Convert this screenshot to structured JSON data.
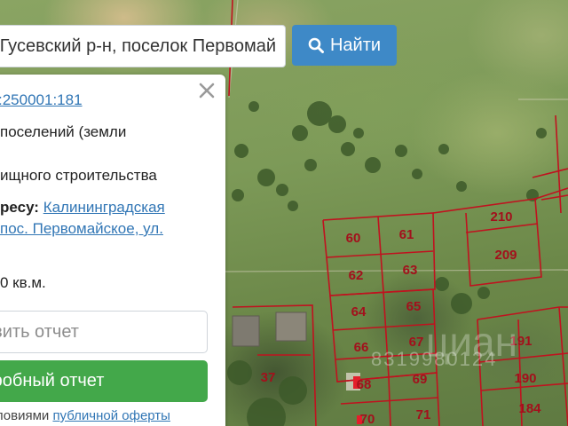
{
  "search": {
    "value": "Гусевский р-н, поселок Первомай",
    "button_label": "Найти",
    "button_icon": "search-icon"
  },
  "panel": {
    "cadastral_number_fragment": ":250001:181",
    "category_line1": "поселений (земли",
    "usage_line": "ищного строительства",
    "address_label": "ресу:",
    "address_link_line1": "Калининградская",
    "address_link_line2": "пос. Первомайское, ул.",
    "area_text": "0 кв.м.",
    "report_placeholder": "авить отчет",
    "detail_button_label": "дробный отчет",
    "terms_prefix": "условиями",
    "terms_link": "публичной оферты",
    "close_icon": "close-icon"
  },
  "map": {
    "plot_numbers": [
      "60",
      "61",
      "62",
      "63",
      "64",
      "65",
      "66",
      "67",
      "68",
      "69",
      "70",
      "71",
      "37",
      "210",
      "209",
      "191",
      "190",
      "184"
    ],
    "watermark": "циан",
    "watermark_phone": "8319980124",
    "boundary_color": "#c0121f",
    "label_color": "#a3101c"
  },
  "colors": {
    "search_button": "#3e89c7",
    "detail_button": "#43a84a",
    "link": "#3176b5"
  }
}
